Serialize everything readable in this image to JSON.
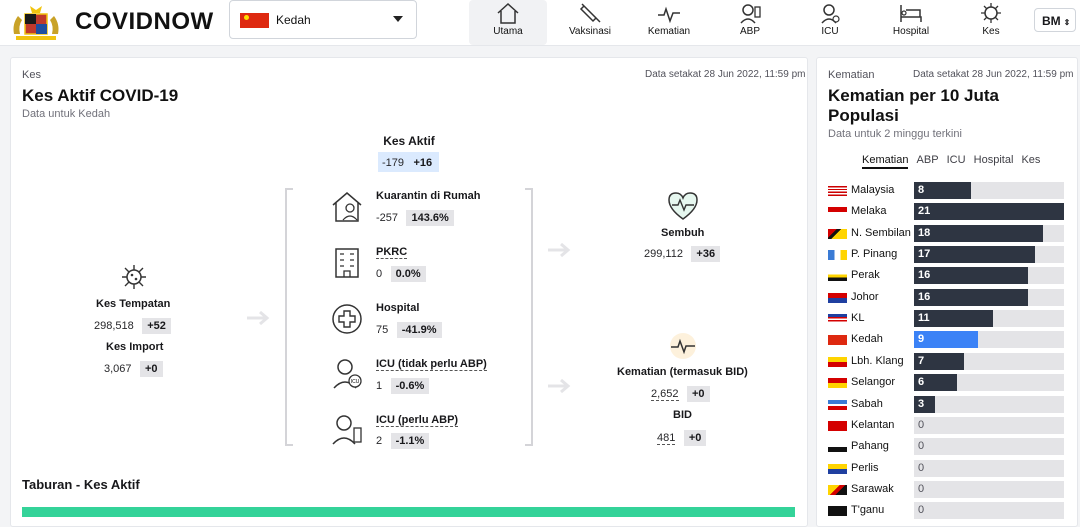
{
  "header": {
    "brand": "COVIDNOW",
    "state_selector": {
      "value": "Kedah"
    },
    "nav": [
      {
        "label": "Utama",
        "icon": "home-icon",
        "active": true
      },
      {
        "label": "Vaksinasi",
        "icon": "syringe-icon"
      },
      {
        "label": "Kematian",
        "icon": "heartbeat-icon"
      },
      {
        "label": "ABP",
        "icon": "ventilator-patient-icon"
      },
      {
        "label": "ICU",
        "icon": "icu-doctor-icon"
      },
      {
        "label": "Hospital",
        "icon": "hospital-bed-icon"
      },
      {
        "label": "Kes",
        "icon": "virus-icon"
      }
    ],
    "language": "BM"
  },
  "main": {
    "eyebrow": "Kes",
    "timestamp": "Data setakat 28 Jun 2022, 11:59 pm",
    "title": "Kes Aktif COVID-19",
    "subtitle": "Data untuk Kedah",
    "active": {
      "title": "Kes Aktif",
      "value": "-179",
      "delta": "+16"
    },
    "local": {
      "title": "Kes Tempatan",
      "value": "298,518",
      "delta": "+52"
    },
    "import": {
      "title": "Kes Import",
      "value": "3,067",
      "delta": "+0"
    },
    "stats": [
      {
        "title": "Kuarantin di Rumah",
        "value": "-257",
        "delta": "143.6%"
      },
      {
        "title": "PKRC",
        "value": "0",
        "delta": "0.0%"
      },
      {
        "title": "Hospital",
        "value": "75",
        "delta": "-41.9%"
      },
      {
        "title": "ICU (tidak perlu ABP)",
        "value": "1",
        "delta": "-0.6%"
      },
      {
        "title": "ICU (perlu ABP)",
        "value": "2",
        "delta": "-1.1%"
      }
    ],
    "recovered": {
      "title": "Sembuh",
      "value": "299,112",
      "delta": "+36"
    },
    "deaths": {
      "title": "Kematian (termasuk BID)",
      "value": "2,652",
      "delta": "+0"
    },
    "bid": {
      "title": "BID",
      "value": "481",
      "delta": "+0"
    },
    "distribution_title": "Taburan - Kes Aktif"
  },
  "side": {
    "eyebrow": "Kematian",
    "timestamp": "Data setakat 28 Jun 2022, 11:59 pm",
    "title_line1": "Kematian per 10 Juta",
    "title_line2": "Populasi",
    "subtitle": "Data untuk 2 minggu terkini",
    "tabs": [
      "Kematian",
      "ABP",
      "ICU",
      "Hospital",
      "Kes"
    ],
    "active_tab": "Kematian",
    "max_value": 21,
    "rows": [
      {
        "name": "Malaysia",
        "value": 8,
        "flag": "malaysia"
      },
      {
        "name": "Melaka",
        "value": 21,
        "flag": "melaka"
      },
      {
        "name": "N. Sembilan",
        "value": 18,
        "flag": "nsembilan"
      },
      {
        "name": "P. Pinang",
        "value": 17,
        "flag": "ppinang"
      },
      {
        "name": "Perak",
        "value": 16,
        "flag": "perak"
      },
      {
        "name": "Johor",
        "value": 16,
        "flag": "johor"
      },
      {
        "name": "KL",
        "value": 11,
        "flag": "kl"
      },
      {
        "name": "Kedah",
        "value": 9,
        "flag": "kedah",
        "highlight": true
      },
      {
        "name": "Lbh. Klang",
        "value": 7,
        "flag": "klang"
      },
      {
        "name": "Selangor",
        "value": 6,
        "flag": "selangor"
      },
      {
        "name": "Sabah",
        "value": 3,
        "flag": "sabah"
      },
      {
        "name": "Kelantan",
        "value": 0,
        "flag": "kelantan"
      },
      {
        "name": "Pahang",
        "value": 0,
        "flag": "pahang"
      },
      {
        "name": "Perlis",
        "value": 0,
        "flag": "perlis"
      },
      {
        "name": "Sarawak",
        "value": 0,
        "flag": "sarawak"
      },
      {
        "name": "T'ganu",
        "value": 0,
        "flag": "tganu"
      }
    ]
  },
  "colors": {
    "bar": "#2e3542",
    "highlight": "#3b82f6",
    "track": "#e4e4e7",
    "accent_green": "#34d399"
  }
}
